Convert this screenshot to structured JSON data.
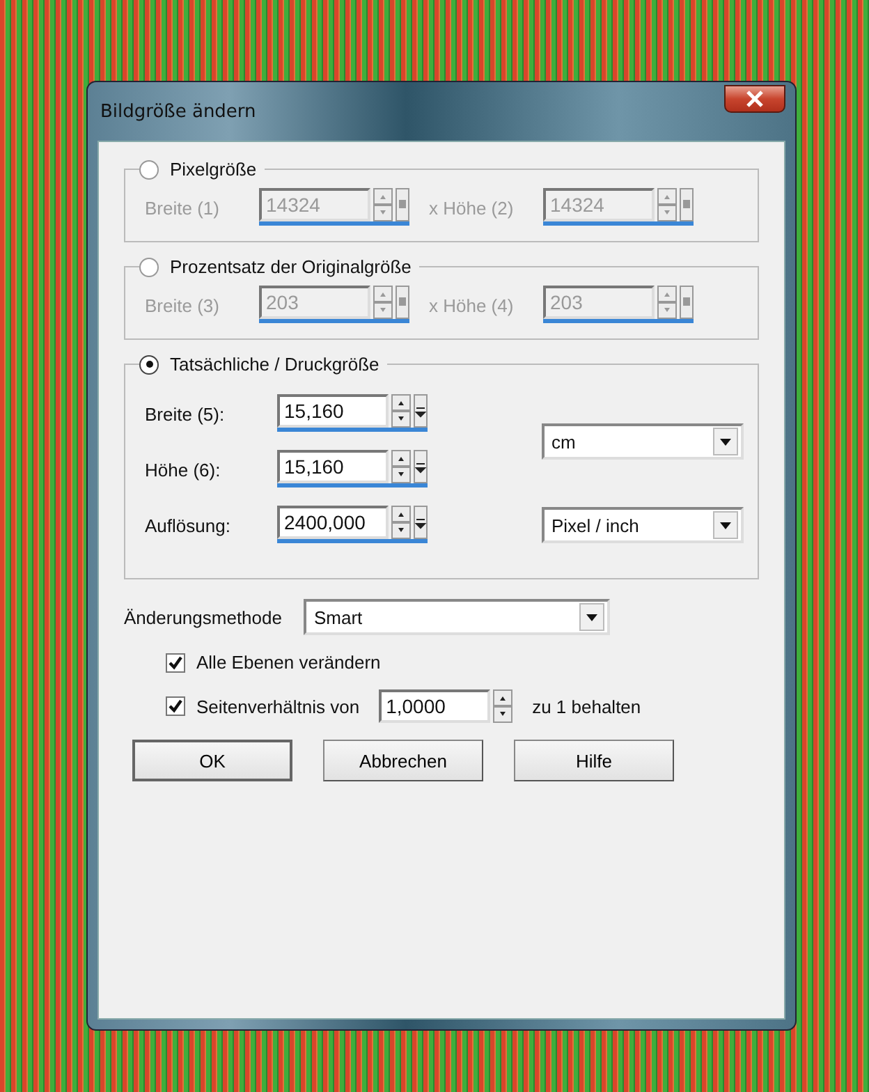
{
  "window": {
    "title": "Bildgröße ändern"
  },
  "groups": [
    {
      "kind": "pair",
      "label": "Pixelgröße",
      "selected": false,
      "disabled": true,
      "fields": [
        {
          "label": "Breite (1)",
          "value": "14324"
        },
        {
          "label": "x Höhe (2)",
          "value": "14324"
        }
      ]
    },
    {
      "kind": "pair",
      "label": "Prozentsatz der Originalgröße",
      "selected": false,
      "disabled": true,
      "fields": [
        {
          "label": "Breite (3)",
          "value": "203"
        },
        {
          "label": "x Höhe (4)",
          "value": "203"
        }
      ]
    },
    {
      "kind": "print",
      "label": "Tatsächliche / Druckgröße",
      "selected": true,
      "disabled": false,
      "fields": [
        {
          "label": "Breite (5):",
          "value": "15,160"
        },
        {
          "label": "Höhe (6):",
          "value": "15,160"
        },
        {
          "label": "Auflösung:",
          "value": "2400,000"
        }
      ],
      "units": [
        {
          "value": "cm"
        },
        {
          "value": "Pixel / inch"
        }
      ]
    }
  ],
  "method": {
    "label": "Änderungsmethode",
    "value": "Smart"
  },
  "options": [
    {
      "kind": "plain",
      "label": "Alle Ebenen verändern",
      "checked": true
    },
    {
      "kind": "ratio",
      "label": "Seitenverhältnis von",
      "checked": true,
      "value": "1,0000",
      "suffix": "zu 1 behalten"
    }
  ],
  "buttons": [
    "OK",
    "Abbrechen",
    "Hilfe"
  ]
}
